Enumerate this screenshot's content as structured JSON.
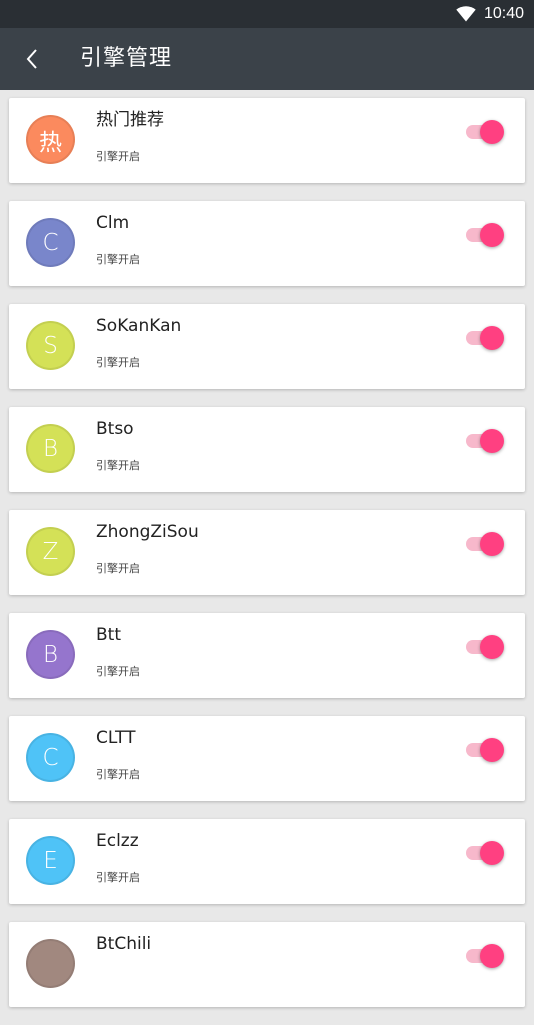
{
  "status_bar": {
    "time": "10:40",
    "icons": [
      "wifi-icon"
    ]
  },
  "toolbar": {
    "back_icon": "chevron-left-icon",
    "title": "引擎管理"
  },
  "engines": [
    {
      "initial": "热",
      "name": "热门推荐",
      "status": "引擎开启",
      "color": "#fb8a5e",
      "enabled": true
    },
    {
      "initial": "C",
      "name": "Clm",
      "status": "引擎开启",
      "color": "#7986cb",
      "enabled": true
    },
    {
      "initial": "S",
      "name": "SoKanKan",
      "status": "引擎开启",
      "color": "#d4e157",
      "enabled": true
    },
    {
      "initial": "B",
      "name": "Btso",
      "status": "引擎开启",
      "color": "#d4e157",
      "enabled": true
    },
    {
      "initial": "Z",
      "name": "ZhongZiSou",
      "status": "引擎开启",
      "color": "#d4e157",
      "enabled": true
    },
    {
      "initial": "B",
      "name": "Btt",
      "status": "引擎开启",
      "color": "#9575cd",
      "enabled": true
    },
    {
      "initial": "C",
      "name": "CLTT",
      "status": "引擎开启",
      "color": "#4fc3f7",
      "enabled": true
    },
    {
      "initial": "E",
      "name": "Eclzz",
      "status": "引擎开启",
      "color": "#4fc3f7",
      "enabled": true
    },
    {
      "initial": "",
      "name": "BtChili",
      "status": "",
      "color": "#a1887f",
      "enabled": true
    }
  ],
  "colors": {
    "status_bar": "#2a2f34",
    "toolbar": "#3b4249",
    "background": "#e8e8e8",
    "switch_thumb": "#ff4081",
    "switch_track": "#f7b8cb"
  }
}
